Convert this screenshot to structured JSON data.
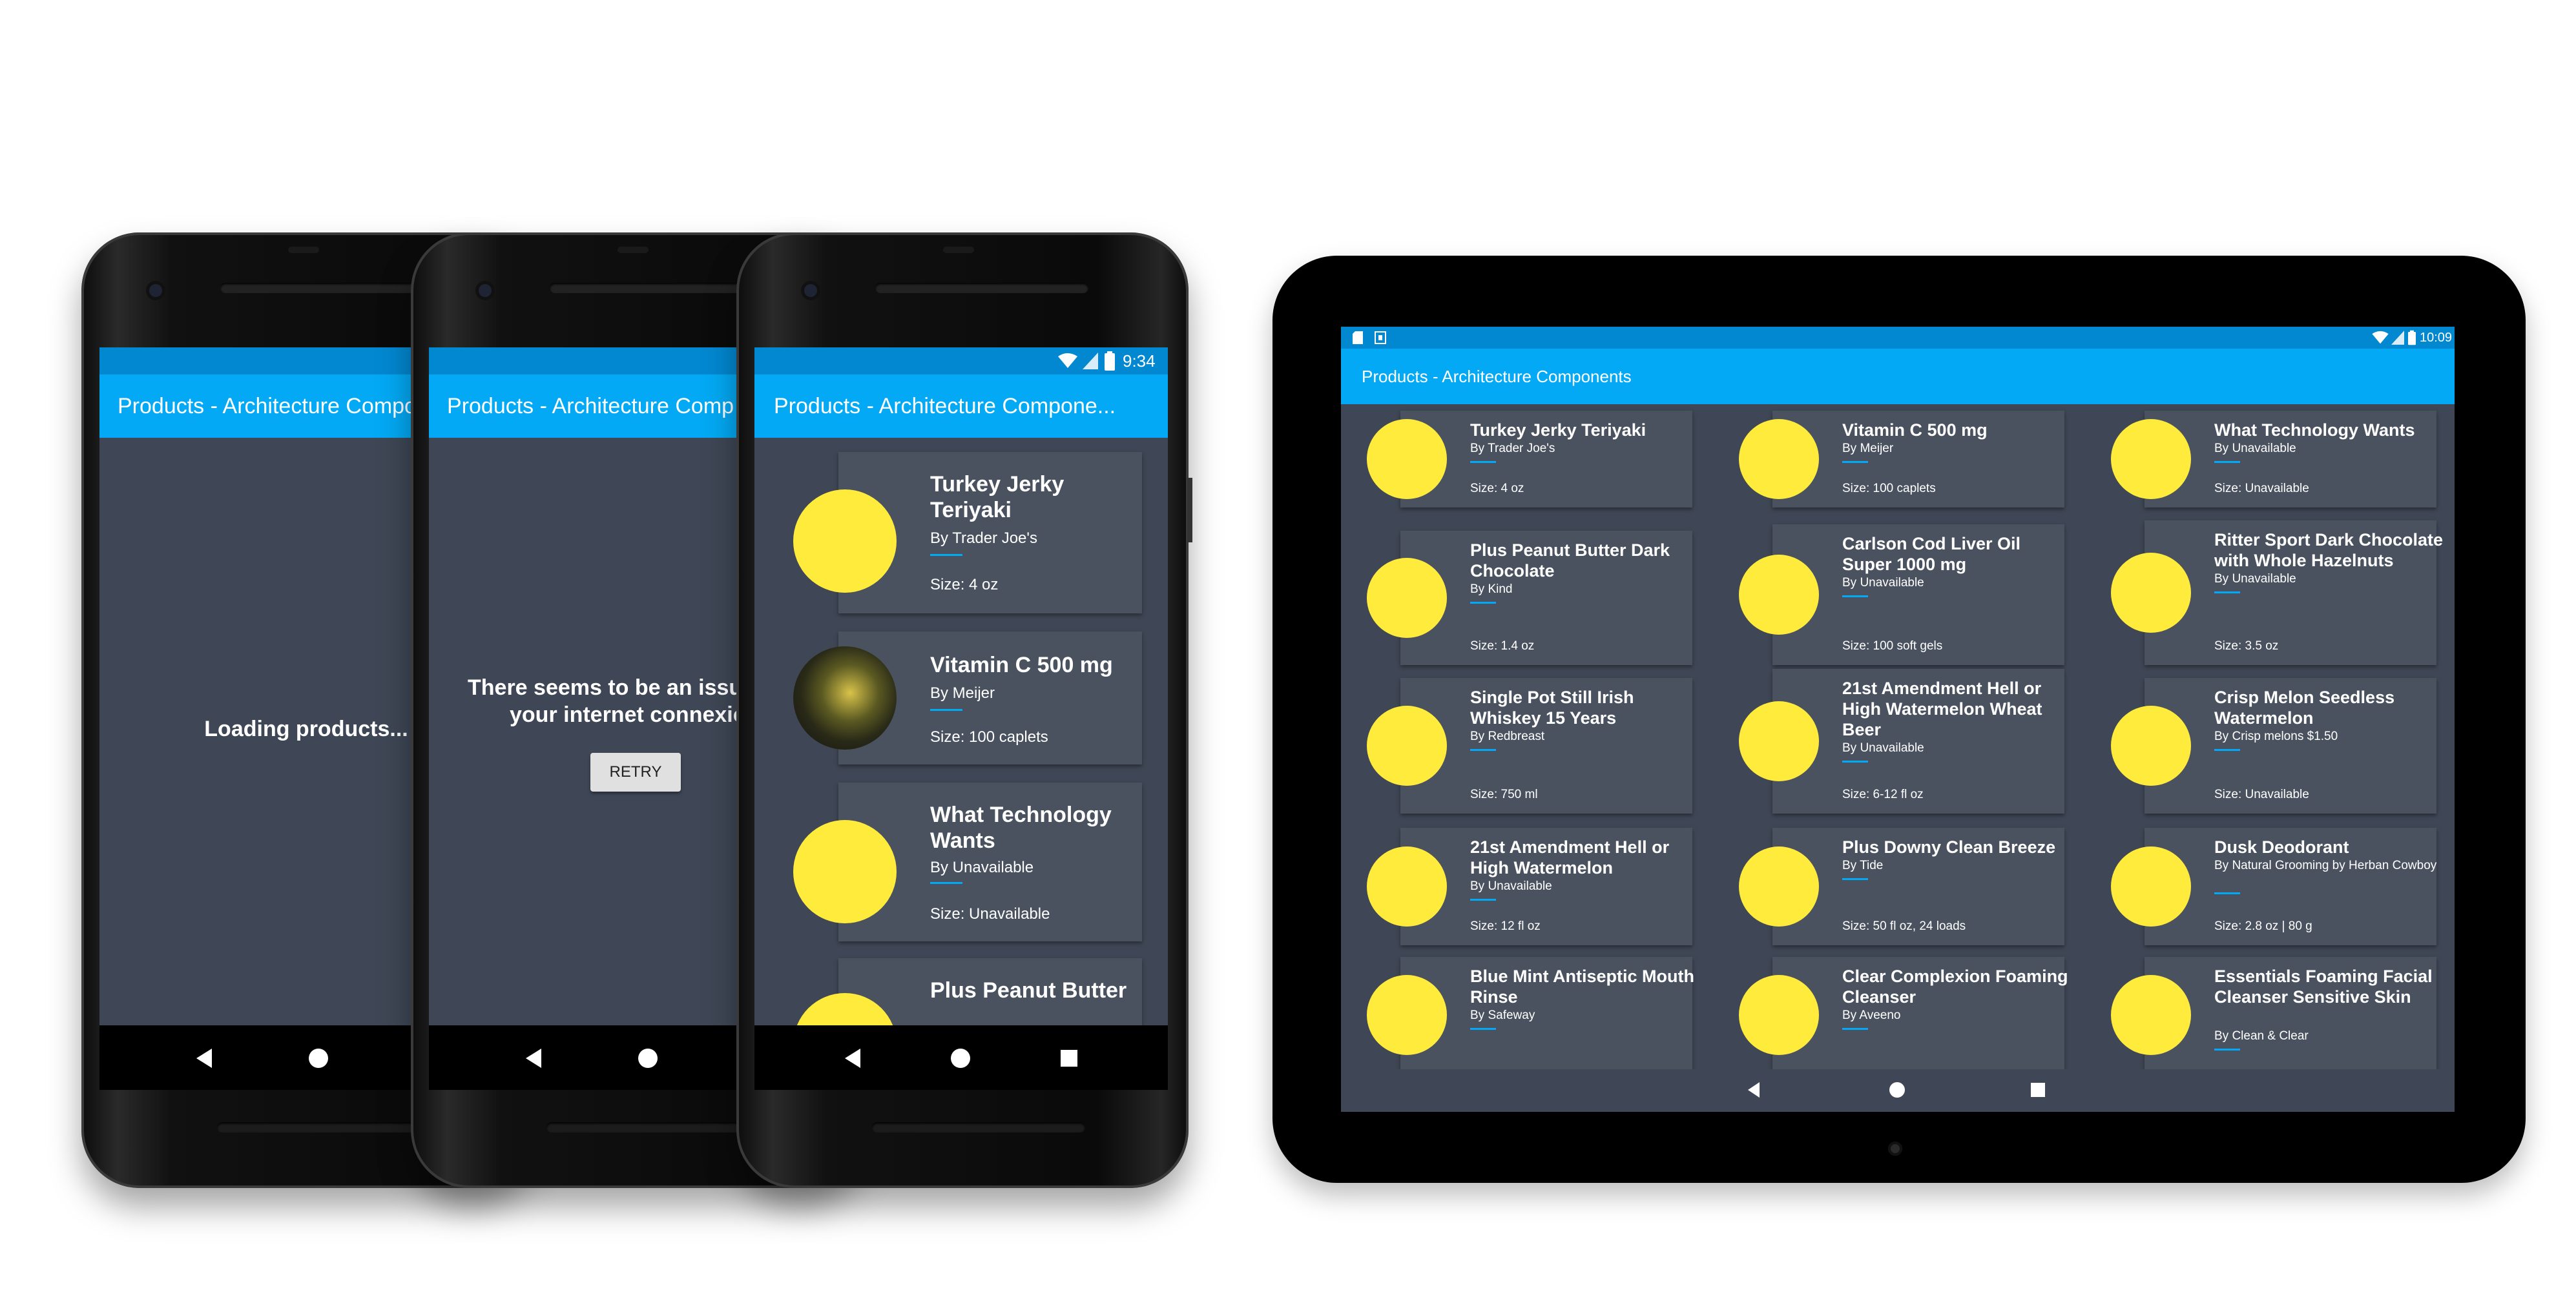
{
  "app_title": "Products - Architecture Components",
  "phone1": {
    "appbar_title": "Products - Architecture Compo",
    "message": "Loading products..."
  },
  "phone2": {
    "appbar_title": "Products - Architecture Comp",
    "error_line1": "There seems to be an issue",
    "error_line2": "your internet connexion",
    "retry_label": "RETRY"
  },
  "phone3": {
    "time": "9:34",
    "appbar_title": "Products - Architecture Compone...",
    "products": [
      {
        "name1": "Turkey Jerky",
        "name2": "Teriyaki",
        "by": "By Trader Joe's",
        "size": "Size: 4 oz",
        "image": "yellow-placeholder"
      },
      {
        "name1": "Vitamin C 500 mg",
        "name2": "",
        "by": "By Meijer",
        "size": "Size: 100 caplets",
        "image": "product-photo"
      },
      {
        "name1": "What Technology",
        "name2": "Wants",
        "by": "By Unavailable",
        "size": "Size: Unavailable",
        "image": "yellow-placeholder"
      },
      {
        "name1": "Plus Peanut Butter",
        "name2": "",
        "by": "",
        "size": "",
        "image": "yellow-placeholder"
      }
    ]
  },
  "tablet": {
    "time": "10:09",
    "appbar_title": "Products - Architecture Components",
    "products": [
      {
        "name": "Turkey Jerky Teriyaki",
        "by": "By Trader Joe's",
        "size": "Size: 4 oz",
        "image": "yellow-placeholder"
      },
      {
        "name": "Vitamin C 500 mg",
        "by": "By Meijer",
        "size": "Size: 100 caplets",
        "image": "product-photo"
      },
      {
        "name": "What Technology Wants",
        "by": "By Unavailable",
        "size": "Size: Unavailable",
        "image": "yellow-placeholder"
      },
      {
        "name": "Plus Peanut Butter Dark Chocolate",
        "by": "By Kind",
        "size": "Size: 1.4 oz",
        "image": "yellow-placeholder"
      },
      {
        "name": "Carlson Cod Liver Oil Super 1000 mg",
        "by": "By Unavailable",
        "size": "Size: 100 soft gels",
        "image": "product-photo"
      },
      {
        "name": "Ritter Sport Dark Chocolate with Whole Hazelnuts",
        "by": "By Unavailable",
        "size": "Size: 3.5 oz",
        "image": "yellow-placeholder"
      },
      {
        "name": "Single Pot Still Irish Whiskey 15 Years",
        "by": "By Redbreast",
        "size": "Size: 750 ml",
        "image": "product-photo"
      },
      {
        "name": "21st Amendment Hell or High Watermelon Wheat Beer",
        "by": "By Unavailable",
        "size": "Size: 6-12 fl oz",
        "image": "yellow-placeholder"
      },
      {
        "name": "Crisp Melon Seedless Watermelon",
        "by": "By Crisp melons $1.50",
        "size": "Size: Unavailable",
        "image": "yellow-placeholder"
      },
      {
        "name": "21st Amendment Hell or High Watermelon",
        "by": "By Unavailable",
        "size": "Size: 12 fl oz",
        "image": "yellow-placeholder"
      },
      {
        "name": "Plus Downy Clean Breeze",
        "by": "By Tide",
        "size": "Size: 50 fl oz, 24 loads",
        "image": "yellow-placeholder"
      },
      {
        "name": "Dusk Deodorant",
        "by": "By Natural Grooming by Herban Cowboy",
        "size": "Size: 2.8 oz | 80 g",
        "image": "product-photo"
      },
      {
        "name": "Blue Mint Antiseptic Mouth Rinse",
        "by": "By Safeway",
        "size": "",
        "image": "yellow-placeholder"
      },
      {
        "name": "Clear Complexion Foaming Cleanser",
        "by": "By Aveeno",
        "size": "",
        "image": "product-photo"
      },
      {
        "name": "Essentials Foaming Facial Cleanser Sensitive Skin",
        "by": "By Clean & Clear",
        "size": "",
        "image": "product-photo"
      }
    ]
  },
  "colors": {
    "primary": "#03a9f4",
    "primary_dark": "#0288d1",
    "background": "#3f4756",
    "card": "#4a5260",
    "placeholder": "#ffeb3b"
  },
  "icons": {
    "nav_back": "back-triangle-icon",
    "nav_home": "home-circle-icon",
    "nav_recents": "recents-square-icon",
    "wifi": "wifi-icon",
    "signal": "signal-icon",
    "battery": "battery-icon"
  }
}
